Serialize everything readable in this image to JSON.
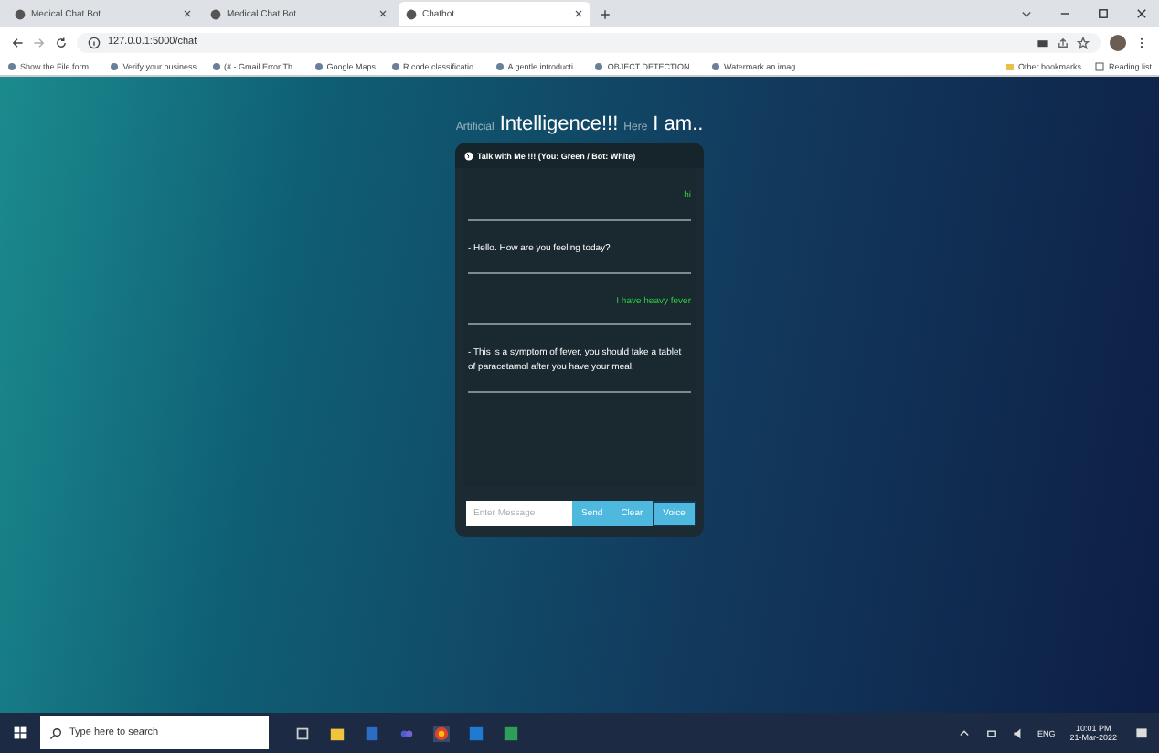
{
  "browser": {
    "tabs": [
      {
        "title": "Medical Chat Bot",
        "selected": false
      },
      {
        "title": "Medical Chat Bot",
        "selected": false
      },
      {
        "title": "Chatbot",
        "selected": true
      }
    ],
    "address": "127.0.0.1:5000/chat",
    "bookmarks": [
      "Show the File form...",
      "Verify your business",
      "(# - Gmail Error Th...",
      "Google Maps",
      "R code classificatio...",
      "A gentle introducti...",
      "OBJECT DETECTION...",
      "Watermark an imag..."
    ],
    "other_bookmarks": "Other bookmarks",
    "reading_list": "Reading list"
  },
  "heading": {
    "parts": [
      {
        "text": "Artificial",
        "kind": "minor"
      },
      {
        "text": "Intelligence!!!",
        "kind": "major"
      },
      {
        "text": "Here",
        "kind": "minor"
      },
      {
        "text": "I am..",
        "kind": "major"
      }
    ]
  },
  "chat": {
    "title": "Talk with Me !!! (You: Green / Bot: White)",
    "messages": [
      {
        "kind": "user",
        "text": "hi"
      },
      {
        "kind": "bot",
        "text": "- Hello. How are you feeling today?"
      },
      {
        "kind": "user",
        "text": "I have heavy fever"
      },
      {
        "kind": "bot",
        "text": "- This is a symptom of fever, you should take a tablet of paracetamol after you have your meal."
      }
    ],
    "input": {
      "placeholder": "Enter Message"
    },
    "buttons": [
      {
        "label": "Send",
        "selected": false
      },
      {
        "label": "Clear",
        "selected": false
      },
      {
        "label": "Voice",
        "selected": true
      }
    ]
  },
  "taskbar": {
    "search_placeholder": "Type here to search",
    "language": "ENG",
    "time": "10:01 PM",
    "date": "21-Mar-2022"
  }
}
